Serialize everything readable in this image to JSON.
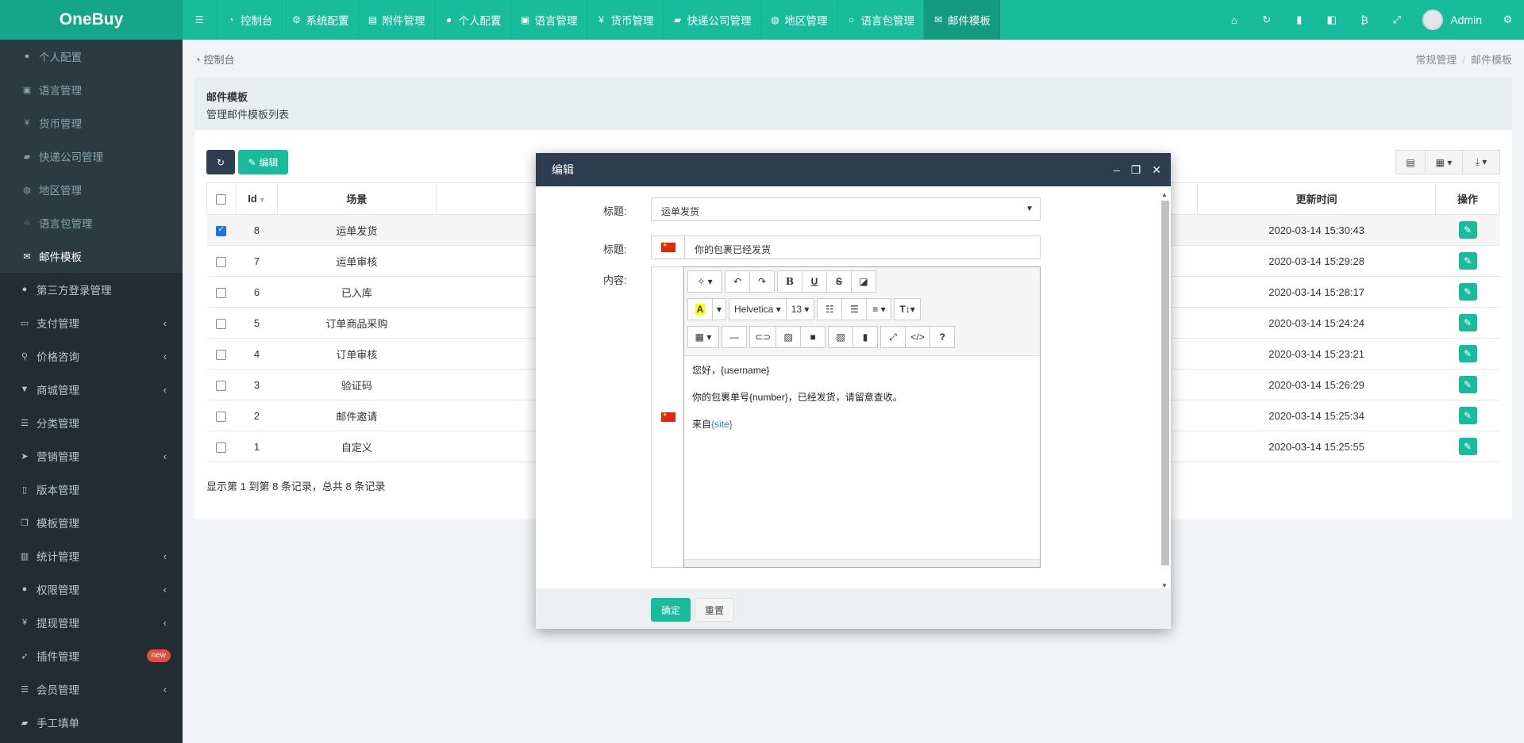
{
  "app": {
    "logo": "OneBuy",
    "user": "Admin"
  },
  "nav_tabs": [
    {
      "label": "",
      "icon": "menu-icon"
    },
    {
      "label": "控制台",
      "icon": "dashboard-icon"
    },
    {
      "label": "系统配置",
      "icon": "gear-icon"
    },
    {
      "label": "附件管理",
      "icon": "file-image-icon"
    },
    {
      "label": "个人配置",
      "icon": "user-icon"
    },
    {
      "label": "语言管理",
      "icon": "language-icon"
    },
    {
      "label": "货币管理",
      "icon": "yen-icon"
    },
    {
      "label": "快递公司管理",
      "icon": "truck-icon"
    },
    {
      "label": "地区管理",
      "icon": "globe-icon"
    },
    {
      "label": "语言包管理",
      "icon": "circle-icon"
    },
    {
      "label": "邮件模板",
      "icon": "envelope-icon"
    }
  ],
  "top_right_icons": [
    "home-icon",
    "refresh-icon",
    "trash-icon",
    "language-icon",
    "bitcoin-icon",
    "fullscreen-icon"
  ],
  "sidebar": {
    "sub_items": [
      {
        "label": "个人配置",
        "icon": "user-icon"
      },
      {
        "label": "语言管理",
        "icon": "language-icon"
      },
      {
        "label": "货币管理",
        "icon": "yen-icon"
      },
      {
        "label": "快递公司管理",
        "icon": "truck-icon"
      },
      {
        "label": "地区管理",
        "icon": "globe-icon"
      },
      {
        "label": "语言包管理",
        "icon": "circle-icon"
      },
      {
        "label": "邮件模板",
        "icon": "envelope-icon",
        "active": true
      }
    ],
    "items": [
      {
        "label": "第三方登录管理",
        "icon": "users-icon"
      },
      {
        "label": "支付管理",
        "icon": "credit-card-icon",
        "expand": true
      },
      {
        "label": "价格咨询",
        "icon": "search-icon",
        "expand": true
      },
      {
        "label": "商城管理",
        "icon": "cart-icon",
        "expand": true
      },
      {
        "label": "分类管理",
        "icon": "list-icon"
      },
      {
        "label": "营销管理",
        "icon": "paper-plane-icon",
        "expand": true
      },
      {
        "label": "版本管理",
        "icon": "file-icon"
      },
      {
        "label": "模板管理",
        "icon": "clone-icon"
      },
      {
        "label": "统计管理",
        "icon": "bar-chart-icon",
        "expand": true
      },
      {
        "label": "权限管理",
        "icon": "group-icon",
        "expand": true
      },
      {
        "label": "提现管理",
        "icon": "yen-icon",
        "expand": true
      },
      {
        "label": "插件管理",
        "icon": "rocket-icon",
        "badge": "new"
      },
      {
        "label": "会员管理",
        "icon": "list-icon",
        "expand": true
      },
      {
        "label": "手工填单",
        "icon": "truck-icon"
      }
    ]
  },
  "breadcrumb": {
    "home": "控制台",
    "path": [
      "常规管理",
      "邮件模板"
    ]
  },
  "panel": {
    "title": "邮件模板",
    "description": "管理邮件模板列表",
    "edit_label": "编辑"
  },
  "table": {
    "headers": {
      "id": "Id",
      "scene": "场景",
      "updated": "更新时间",
      "ops": "操作"
    },
    "rows": [
      {
        "id": "8",
        "scene": "运单发货",
        "updated": "2020-03-14 15:30:43",
        "checked": true
      },
      {
        "id": "7",
        "scene": "运单审核",
        "updated": "2020-03-14 15:29:28"
      },
      {
        "id": "6",
        "scene": "已入库",
        "updated": "2020-03-14 15:28:17"
      },
      {
        "id": "5",
        "scene": "订单商品采购",
        "updated": "2020-03-14 15:24:24"
      },
      {
        "id": "4",
        "scene": "订单审核",
        "updated": "2020-03-14 15:23:21"
      },
      {
        "id": "3",
        "scene": "验证码",
        "updated": "2020-03-14 15:26:29"
      },
      {
        "id": "2",
        "scene": "邮件邀请",
        "updated": "2020-03-14 15:25:34"
      },
      {
        "id": "1",
        "scene": "自定义",
        "updated": "2020-03-14 15:25:55"
      }
    ],
    "footer": "显示第 1 到第 8 条记录，总共 8 条记录"
  },
  "modal": {
    "title": "编辑",
    "scene_label": "标题:",
    "scene_value": "运单发货",
    "subject_label": "标题:",
    "subject_value": "你的包裹已经发货",
    "content_label": "内容:",
    "editor": {
      "font": "Helvetica",
      "size": "13",
      "lines": [
        "您好，{username}",
        "你的包裹单号{number}，已经发货，请留意查收。"
      ],
      "from_prefix": "来自",
      "from_site": "{site}"
    },
    "ok_label": "确定",
    "reset_label": "重置"
  }
}
